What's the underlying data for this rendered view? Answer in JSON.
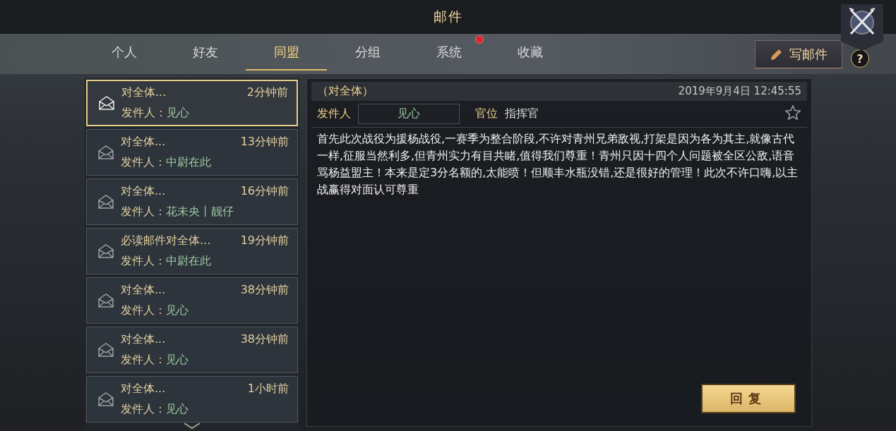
{
  "window": {
    "title": "邮件"
  },
  "tabs": [
    {
      "label": "个人",
      "selected": false,
      "notification": false
    },
    {
      "label": "好友",
      "selected": false,
      "notification": false
    },
    {
      "label": "同盟",
      "selected": true,
      "notification": false
    },
    {
      "label": "分组",
      "selected": false,
      "notification": false
    },
    {
      "label": "系统",
      "selected": false,
      "notification": true
    },
    {
      "label": "收藏",
      "selected": false,
      "notification": false
    }
  ],
  "compose_button": {
    "label": "写邮件"
  },
  "help_button": {
    "label": "?"
  },
  "mail_list": [
    {
      "subject": "对全体...",
      "time": "2分钟前",
      "sender_label": "发件人：",
      "sender": "见心",
      "selected": true
    },
    {
      "subject": "对全体...",
      "time": "13分钟前",
      "sender_label": "发件人：",
      "sender": "中尉在此",
      "selected": false
    },
    {
      "subject": "对全体...",
      "time": "16分钟前",
      "sender_label": "发件人：",
      "sender": "花未央丨靓仔",
      "selected": false
    },
    {
      "subject": "必读邮件对全体...",
      "time": "19分钟前",
      "sender_label": "发件人：",
      "sender": "中尉在此",
      "selected": false
    },
    {
      "subject": "对全体...",
      "time": "38分钟前",
      "sender_label": "发件人：",
      "sender": "见心",
      "selected": false
    },
    {
      "subject": "对全体...",
      "time": "38分钟前",
      "sender_label": "发件人：",
      "sender": "见心",
      "selected": false
    },
    {
      "subject": "对全体...",
      "time": "1小时前",
      "sender_label": "发件人：",
      "sender": "见心",
      "selected": false
    }
  ],
  "detail": {
    "subject": "（对全体）",
    "date": "2019年9月4日 12:45:55",
    "sender_label": "发件人",
    "sender": "见心",
    "rank_label": "官位",
    "rank": "指挥官",
    "favorited": false,
    "body": "首先此次战役为援杨战役,一赛季为整合阶段,不许对青州兄弟敌视,打架是因为各为其主,就像古代一样,征服当然利多,但青州实力有目共睹,值得我们尊重！青州只因十四个人问题被全区公敌,语音骂杨益盟主！本来是定3分名额的,太能喷！但顺丰水瓶没错,还是很好的管理！此次不许口嗨,以主战赢得对面认可尊重",
    "reply_button": {
      "label": "回复"
    }
  }
}
